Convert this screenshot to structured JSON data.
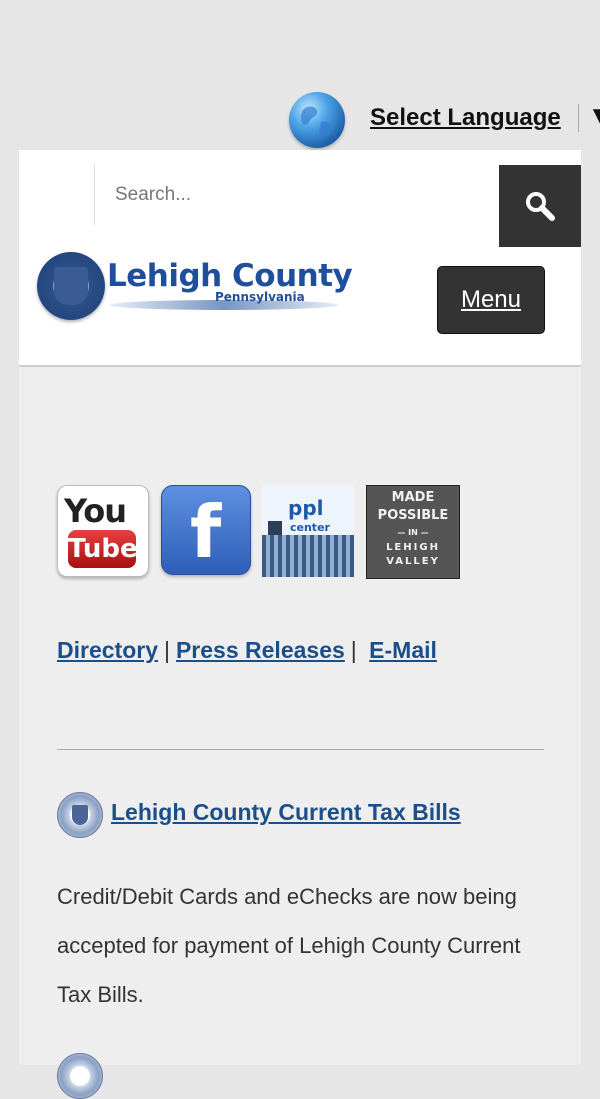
{
  "language": {
    "label": "Select Language",
    "arrow": "▼"
  },
  "search": {
    "placeholder": "Search..."
  },
  "logo": {
    "title": "Lehigh County",
    "subtitle": "Pennsylvania"
  },
  "menu": {
    "label": "Menu"
  },
  "social": {
    "youtube": {
      "top": "You",
      "bottom": "Tube"
    },
    "facebook": {
      "letter": "f"
    },
    "ppl": {
      "name": "ppl",
      "sub": "center"
    },
    "made_possible": {
      "line1": "MADE",
      "line2": "POSSIBLE",
      "line3": "— IN —",
      "line4": "LEHIGH",
      "line5": "VALLEY"
    }
  },
  "links": {
    "directory": "Directory",
    "press": "Press Releases",
    "email": "E-Mail",
    "separator": "|"
  },
  "news": {
    "title": "Lehigh County Current Tax Bills",
    "body": "Credit/Debit Cards and eChecks are now being accepted for payment of Lehigh County Current Tax Bills."
  }
}
